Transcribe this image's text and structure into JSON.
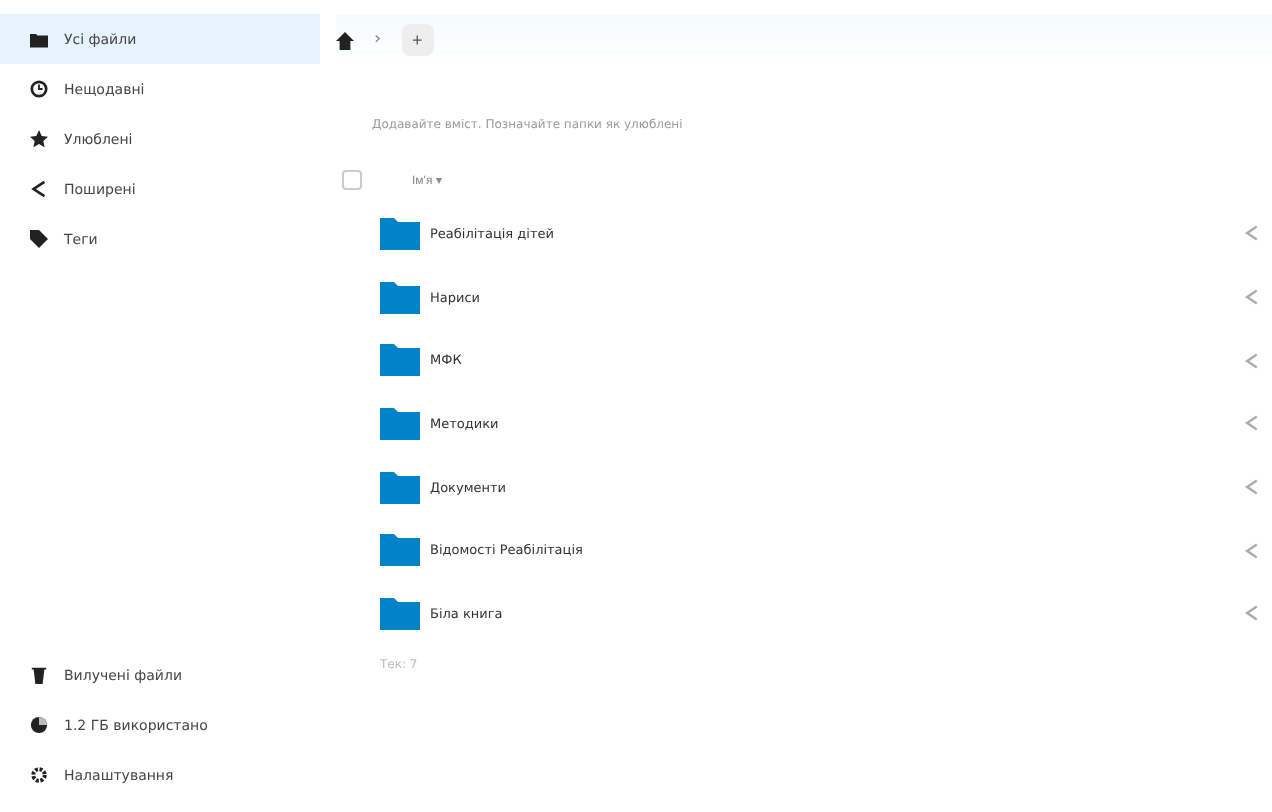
{
  "sidebar": {
    "items": [
      {
        "label": "Усі файли",
        "selected": true
      },
      {
        "label": "Нещодавні",
        "selected": false
      },
      {
        "label": "Улюблені",
        "selected": false
      },
      {
        "label": "Поширені",
        "selected": false
      },
      {
        "label": "Теги",
        "selected": false
      }
    ],
    "bottom": [
      {
        "label": "Вилучені файли"
      },
      {
        "label": "1.2 ГБ використано"
      },
      {
        "label": "Налаштування"
      }
    ]
  },
  "breadcrumb": {
    "separator": "›",
    "add": "+"
  },
  "hint": "Додавайте вміст. Позначайте папки як улюблені",
  "table": {
    "select_all": {
      "checked": false
    },
    "name_column": "Ім'я ▾",
    "rows": [
      {
        "name": "Реабілітація дітей"
      },
      {
        "name": "Нариси"
      },
      {
        "name": "МФК"
      },
      {
        "name": "Методики"
      },
      {
        "name": "Документи"
      },
      {
        "name": "Відомості Реабілітація"
      },
      {
        "name": "Біла книга"
      }
    ],
    "summary": "Тек: 7"
  }
}
